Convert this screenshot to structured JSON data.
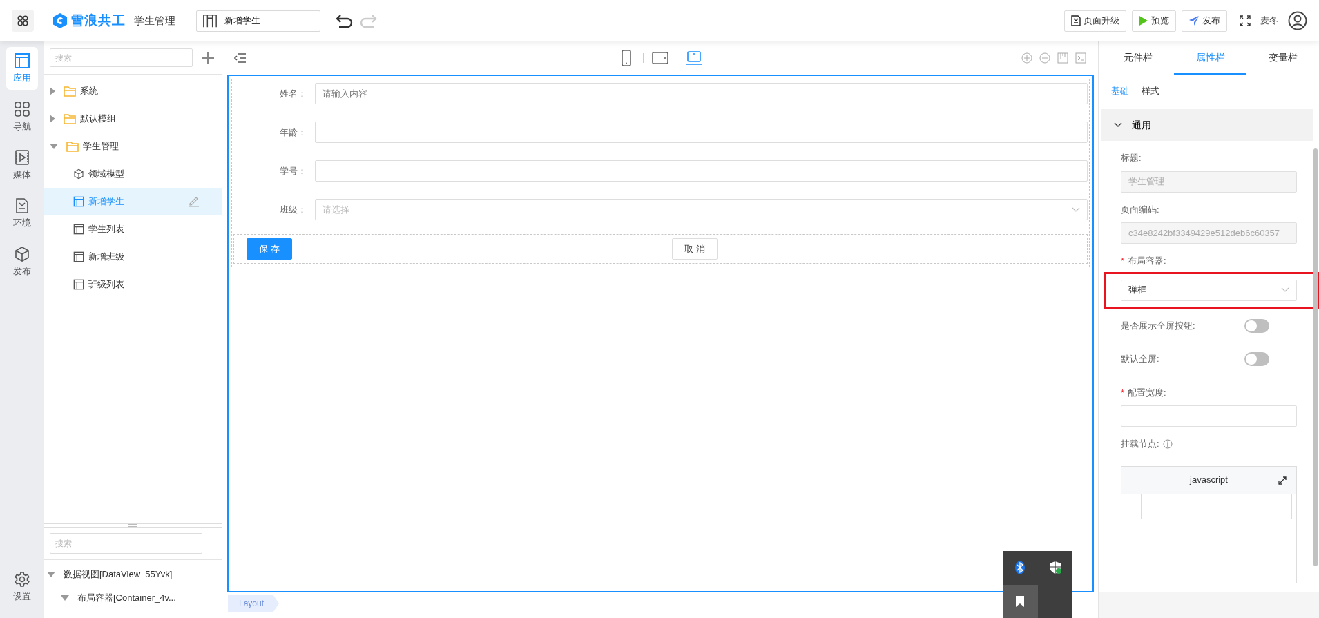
{
  "header": {
    "logo_text": "雪浪共工",
    "app_name": "学生管理",
    "page_selector": "新增学生",
    "undo_enabled": true,
    "redo_enabled": false,
    "buttons": [
      {
        "label": "页面升级",
        "kind": "upgrade"
      },
      {
        "label": "预览",
        "kind": "preview"
      },
      {
        "label": "发布",
        "kind": "publish"
      }
    ],
    "user_name": "麦冬"
  },
  "rail": {
    "items": [
      {
        "label": "应用",
        "kind": "app",
        "selected": true
      },
      {
        "label": "导航",
        "kind": "navigation",
        "selected": false
      },
      {
        "label": "媒体",
        "kind": "media",
        "selected": false
      },
      {
        "label": "环境",
        "kind": "environment",
        "selected": false
      },
      {
        "label": "发布",
        "kind": "publish",
        "selected": false
      }
    ],
    "bottom_item": {
      "label": "设置"
    }
  },
  "tree": {
    "search_placeholder": "搜索",
    "items": [
      {
        "label": "系统",
        "kind": "folder",
        "expanded": false,
        "selected": false
      },
      {
        "label": "默认模组",
        "kind": "folder",
        "expanded": false,
        "selected": false
      },
      {
        "label": "学生管理",
        "kind": "folder",
        "expanded": true,
        "selected": false,
        "children": [
          {
            "label": "领域模型",
            "kind": "model",
            "selected": false
          },
          {
            "label": "新增学生",
            "kind": "page",
            "selected": true
          },
          {
            "label": "学生列表",
            "kind": "page",
            "selected": false
          },
          {
            "label": "新增班级",
            "kind": "page",
            "selected": false
          },
          {
            "label": "班级列表",
            "kind": "page",
            "selected": false
          }
        ]
      }
    ]
  },
  "outline": {
    "search_placeholder": "搜索",
    "items": [
      {
        "label": "数据视图[DataView_55Yvk]",
        "expanded": true,
        "children": [
          {
            "label": "布局容器[Container_4v...",
            "expanded": true
          }
        ]
      }
    ]
  },
  "canvas": {
    "devices": [
      {
        "kind": "phone",
        "selected": false
      },
      {
        "kind": "tablet",
        "selected": false
      },
      {
        "kind": "desktop",
        "selected": true
      }
    ],
    "form": {
      "fields": [
        {
          "label": "姓名：",
          "kind": "input",
          "placeholder": "请输入内容"
        },
        {
          "label": "年龄：",
          "kind": "input"
        },
        {
          "label": "学号：",
          "kind": "input"
        },
        {
          "label": "班级：",
          "kind": "select",
          "placeholder": "请选择"
        }
      ],
      "buttons": [
        {
          "label": "保 存",
          "kind": "primary"
        },
        {
          "label": "取 消",
          "kind": "default"
        }
      ]
    },
    "breadcrumb": "Layout"
  },
  "properties": {
    "tabs": [
      {
        "label": "元件栏",
        "selected": false
      },
      {
        "label": "属性栏",
        "selected": true
      },
      {
        "label": "变量栏",
        "selected": false
      }
    ],
    "subtabs": [
      {
        "label": "基础",
        "selected": true
      },
      {
        "label": "样式",
        "selected": false
      }
    ],
    "section": {
      "title": "通用",
      "expanded": true,
      "fields": [
        {
          "kind": "text",
          "label": "标题:",
          "value": "学生管理",
          "disabled": true
        },
        {
          "kind": "text",
          "label": "页面编码:",
          "value": "c34e8242bf3349429e512deb6c60357",
          "disabled": true
        },
        {
          "kind": "select",
          "label": "布局容器:",
          "required_mark": "*",
          "value": "弹框",
          "highlighted": true
        },
        {
          "kind": "switch",
          "label": "是否展示全屏按钮:",
          "on": false
        },
        {
          "kind": "switch",
          "label": "默认全屏:",
          "on": false
        },
        {
          "kind": "text",
          "label": "配置宽度:",
          "required_mark": "*",
          "disabled": false
        },
        {
          "kind": "code",
          "label": "挂载节点:",
          "language": "javascript"
        }
      ]
    }
  }
}
